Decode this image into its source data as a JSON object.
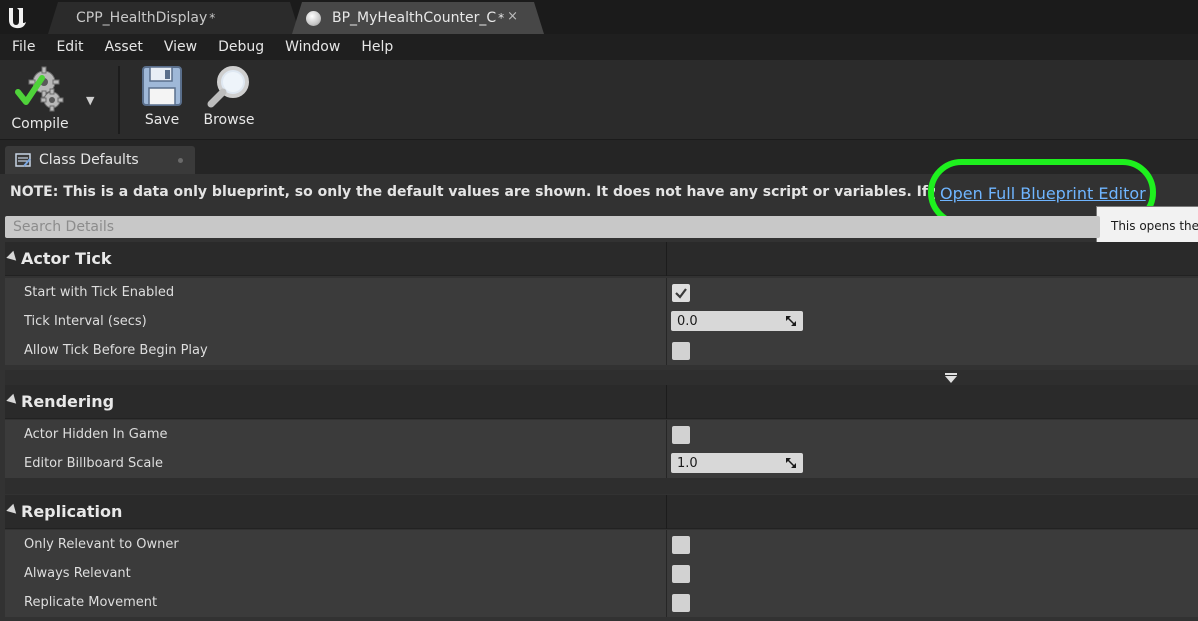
{
  "tabs": [
    {
      "label": "CPP_HealthDisplay",
      "dirty": "*"
    },
    {
      "label": "BP_MyHealthCounter_C",
      "dirty": "*",
      "close": "×"
    }
  ],
  "menu": [
    "File",
    "Edit",
    "Asset",
    "View",
    "Debug",
    "Window",
    "Help"
  ],
  "toolbar": {
    "compile_label": "Compile",
    "compile_dropdown": "▼",
    "save_label": "Save",
    "browse_label": "Browse"
  },
  "panel": {
    "tab_label": "Class Defaults"
  },
  "note": {
    "text": "NOTE: This is a data only blueprint, so only the default values are shown.  It does not have any script or variables.  If you want to add some,",
    "link": "Open Full Blueprint Editor",
    "tooltip": "This opens the"
  },
  "search": {
    "placeholder": "Search Details"
  },
  "categories": [
    {
      "title": "Actor Tick",
      "rows": [
        {
          "label": "Start with Tick Enabled",
          "type": "checkbox",
          "checked": true
        },
        {
          "label": "Tick Interval (secs)",
          "type": "number",
          "value": "0.0"
        },
        {
          "label": "Allow Tick Before Begin Play",
          "type": "checkbox",
          "checked": false
        }
      ]
    },
    {
      "title": "Rendering",
      "rows": [
        {
          "label": "Actor Hidden In Game",
          "type": "checkbox",
          "checked": false
        },
        {
          "label": "Editor Billboard Scale",
          "type": "number",
          "value": "1.0"
        }
      ]
    },
    {
      "title": "Replication",
      "rows": [
        {
          "label": "Only Relevant to Owner",
          "type": "checkbox",
          "checked": false
        },
        {
          "label": "Always Relevant",
          "type": "checkbox",
          "checked": false
        },
        {
          "label": "Replicate Movement",
          "type": "checkbox",
          "checked": false
        }
      ]
    }
  ],
  "colors": {
    "highlight": "#1ef01e",
    "link": "#6fb5ff"
  }
}
